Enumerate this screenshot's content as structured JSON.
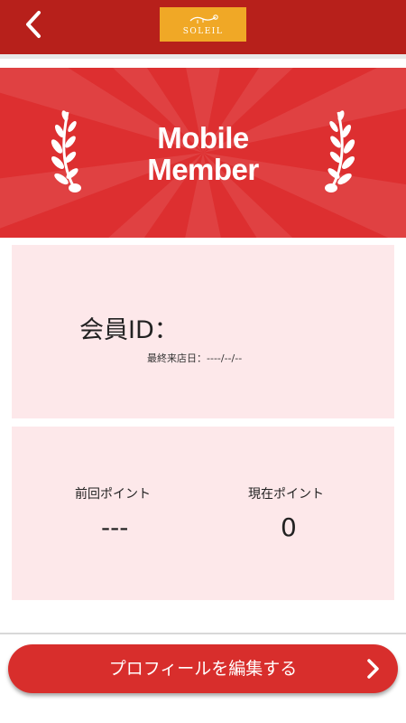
{
  "header": {
    "back_icon": "chevron-left-icon",
    "logo_text": "SOLEIL",
    "background_color": "#b7201b",
    "logo_color": "#f0a826"
  },
  "banner": {
    "line1": "Mobile",
    "line2": "Member",
    "background_color": "#dd2f30",
    "left_icon": "laurel-left-icon",
    "right_icon": "laurel-right-icon"
  },
  "member_card": {
    "member_id_label": "会員ID：",
    "last_visit_label": "最終来店日：----/--/--",
    "background_color": "#fde8ea"
  },
  "points_card": {
    "previous_label": "前回ポイント",
    "previous_value": "---",
    "current_label": "現在ポイント",
    "current_value": "0"
  },
  "edit_button": {
    "label": "プロフィールを編集する",
    "icon": "chevron-right-icon",
    "color": "#d82e2c"
  }
}
